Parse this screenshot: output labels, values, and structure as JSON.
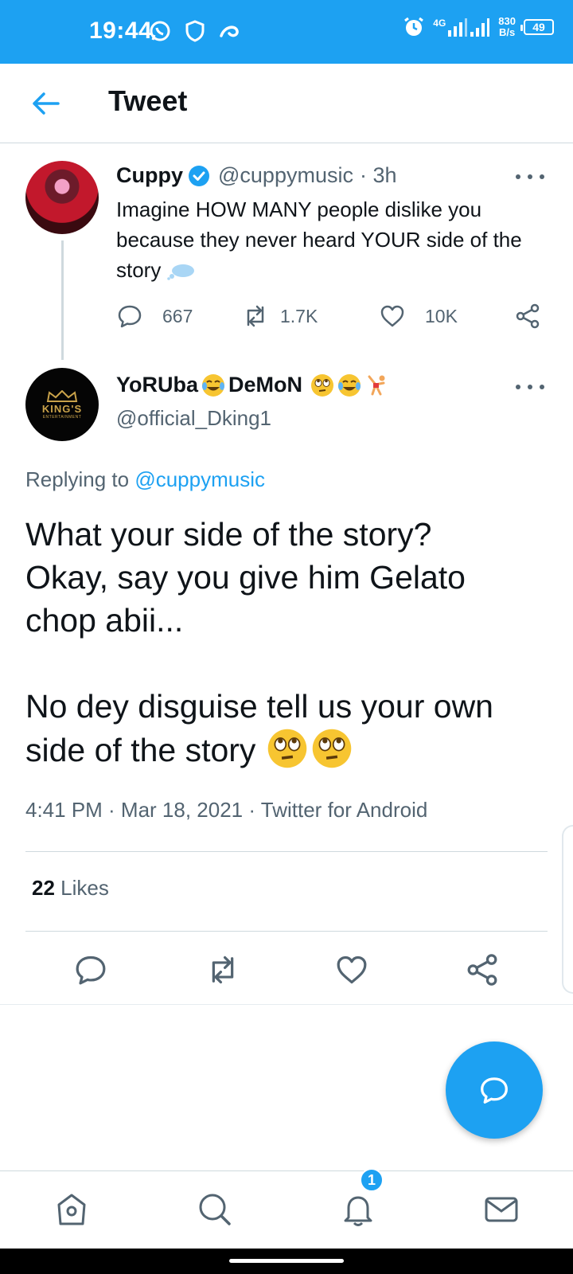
{
  "status_bar": {
    "time": "19:44",
    "network": "4G",
    "net_speed_value": "830",
    "net_speed_unit": "B/s",
    "battery": "49"
  },
  "header": {
    "title": "Tweet"
  },
  "parent_tweet": {
    "display_name": "Cuppy",
    "handle": "@cuppymusic",
    "time": "· 3h",
    "text": "Imagine HOW MANY people dislike you because they never heard YOUR side of the story",
    "replies": "667",
    "retweets": "1.7K",
    "likes": "10K"
  },
  "main_tweet": {
    "display_name_part1": "YoRUba",
    "display_name_part2": "DeMoN",
    "handle": "@official_Dking1",
    "avatar_text_top": "KING'S",
    "avatar_text_bottom": "ENTERTAINMENT",
    "replying_prefix": "Replying to",
    "replying_handle": "@cuppymusic",
    "text_line1": "What your side of the story?\nOkay, say you give him Gelato\nchop abii...\n\nNo dey disguise tell us your own\nside of the story",
    "timestamp": "4:41 PM · Mar 18, 2021 · Twitter for Android",
    "likes_count": "22",
    "likes_label": "Likes"
  },
  "bottom_nav": {
    "notifications_badge": "1"
  },
  "colors": {
    "brand": "#1da1f2",
    "text": "#0f1419",
    "muted": "#536471"
  }
}
